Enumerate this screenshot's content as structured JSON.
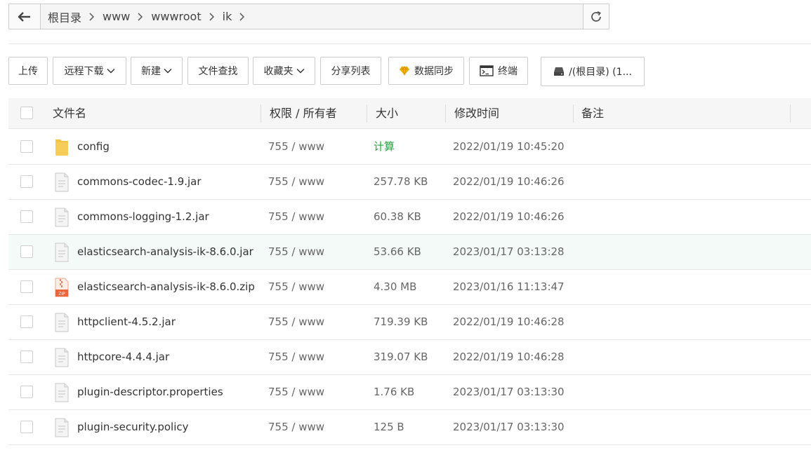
{
  "path": {
    "crumbs": [
      "根目录",
      "www",
      "wwwroot",
      "ik"
    ]
  },
  "toolbar": {
    "upload": "上传",
    "remote_download": "远程下载",
    "new": "新建",
    "file_search": "文件查找",
    "favorites": "收藏夹",
    "share_list": "分享列表",
    "data_sync": "数据同步",
    "terminal": "终端",
    "disk": "/(根目录) (1..."
  },
  "table": {
    "headers": {
      "name": "文件名",
      "perm": "权限 / 所有者",
      "size": "大小",
      "mtime": "修改时间",
      "note": "备注"
    },
    "rows": [
      {
        "type": "folder",
        "name": "config",
        "perm": "755 / www",
        "size": "计算",
        "mtime": "2022/01/19 10:45:20"
      },
      {
        "type": "file",
        "name": "commons-codec-1.9.jar",
        "perm": "755 / www",
        "size": "257.78 KB",
        "mtime": "2022/01/19 10:46:26"
      },
      {
        "type": "file",
        "name": "commons-logging-1.2.jar",
        "perm": "755 / www",
        "size": "60.38 KB",
        "mtime": "2022/01/19 10:46:26"
      },
      {
        "type": "file",
        "name": "elasticsearch-analysis-ik-8.6.0.jar",
        "perm": "755 / www",
        "size": "53.66 KB",
        "mtime": "2023/01/17 03:13:28",
        "highlight": true
      },
      {
        "type": "zip",
        "name": "elasticsearch-analysis-ik-8.6.0.zip",
        "perm": "755 / www",
        "size": "4.30 MB",
        "mtime": "2023/01/16 11:13:47"
      },
      {
        "type": "file",
        "name": "httpclient-4.5.2.jar",
        "perm": "755 / www",
        "size": "719.39 KB",
        "mtime": "2022/01/19 10:46:28"
      },
      {
        "type": "file",
        "name": "httpcore-4.4.4.jar",
        "perm": "755 / www",
        "size": "319.07 KB",
        "mtime": "2022/01/19 10:46:28"
      },
      {
        "type": "file",
        "name": "plugin-descriptor.properties",
        "perm": "755 / www",
        "size": "1.76 KB",
        "mtime": "2023/01/17 03:13:30"
      },
      {
        "type": "file",
        "name": "plugin-security.policy",
        "perm": "755 / www",
        "size": "125 B",
        "mtime": "2023/01/17 03:13:30"
      }
    ]
  },
  "colors": {
    "accent_green": "#20a53a",
    "folder_yellow": "#f5c242",
    "zip_orange": "#f0643c"
  },
  "icons": {
    "back": "arrow-left-icon",
    "refresh": "refresh-icon",
    "sync": "diamond-icon",
    "terminal": "terminal-icon",
    "disk": "disk-icon",
    "folder": "folder-icon",
    "file": "file-icon",
    "zip": "zip-file-icon"
  }
}
